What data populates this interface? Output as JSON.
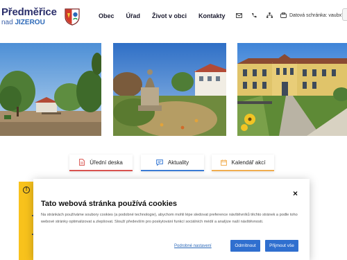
{
  "header": {
    "logo_line1": "Předměřice",
    "logo_line2_a": "nad ",
    "logo_line2_b": "JIZEROU",
    "nav": [
      "Obec",
      "Úřad",
      "Život v obci",
      "Kontakty"
    ],
    "tools": {
      "icons": [
        "envelope-icon",
        "phone-icon",
        "sitemap-icon"
      ],
      "databox_label": "Datová schránka: vaubx7o"
    }
  },
  "quick_links": [
    {
      "label": "Úřední deska",
      "icon": "document-icon",
      "color": "#d9534f"
    },
    {
      "label": "Aktuality",
      "icon": "chat-icon",
      "color": "#3a7bd5"
    },
    {
      "label": "Kalendář akcí",
      "icon": "calendar-icon",
      "color": "#f0ad4e"
    }
  ],
  "notice": {
    "icon": "!"
  },
  "cookies": {
    "close": "×",
    "title": "Tato webová stránka používá cookies",
    "text": "Na stránkách používáme soubory cookies (a podobné technologie), abychom mohli lépe sledovat preference návštěvníků těchto stránek a podle toho webové stránky optimalizovat a zlepšovat. Slouží především pro poskytování funkcí sociálních médií a analýze naší návštěvnosti.",
    "settings_label": "Podrobné nastavení",
    "decline_label": "Odmítnout",
    "accept_label": "Přijmout vše"
  },
  "colors": {
    "brand_dark": "#2b2f6b",
    "brand_blue": "#2f6fcf",
    "notice_yellow": "#f8c21c"
  }
}
